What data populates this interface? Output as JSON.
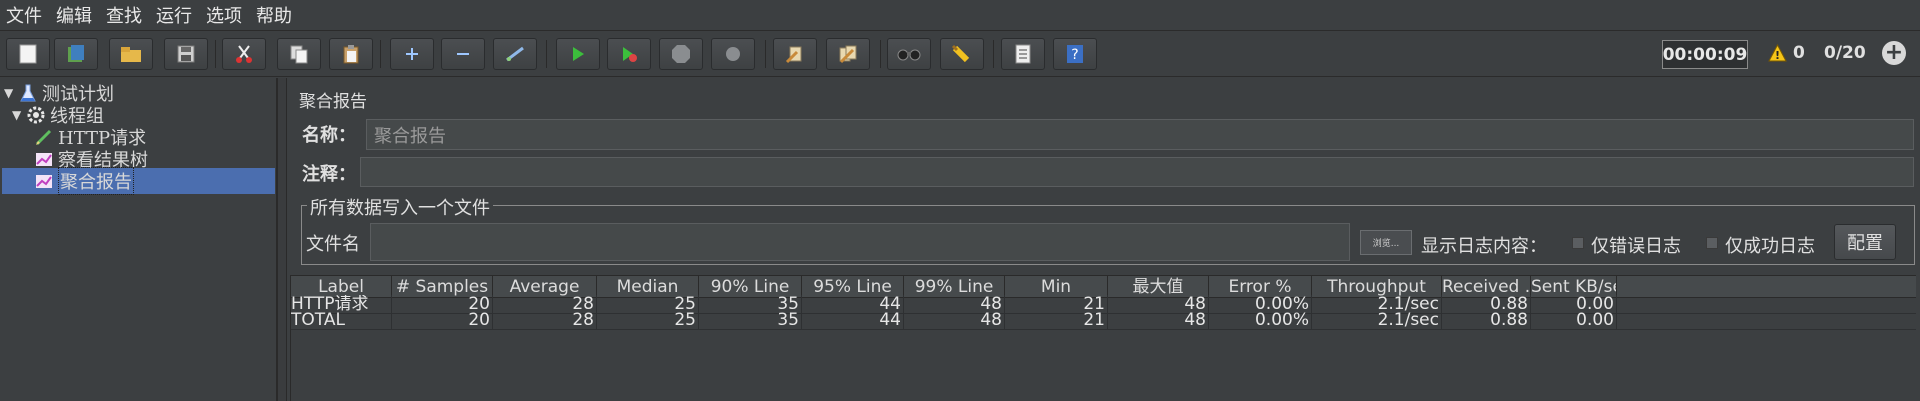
{
  "menu": [
    "文件",
    "编辑",
    "查找",
    "运行",
    "选项",
    "帮助"
  ],
  "toolbar": {
    "buttons": [
      "new-icon",
      "templates-icon",
      "open-icon",
      "save-icon",
      "cut-icon",
      "copy-icon",
      "paste-icon",
      "expand-icon",
      "collapse-icon",
      "toggle-icon",
      "start-icon",
      "start-no-pause-icon",
      "stop-icon",
      "shutdown-icon",
      "clear-icon",
      "clear-all-icon",
      "search-icon",
      "reset-search-icon",
      "function-helper-icon",
      "help-icon"
    ],
    "timer": "00:00:09",
    "warning_count": "0",
    "threads": "0/20"
  },
  "tree": {
    "items": [
      {
        "label": "测试计划",
        "icon": "flask-icon"
      },
      {
        "label": "线程组",
        "icon": "gear-icon"
      },
      {
        "label": "HTTP请求",
        "icon": "pencil-icon"
      },
      {
        "label": "察看结果树",
        "icon": "chart-icon"
      },
      {
        "label": "聚合报告",
        "icon": "chart-icon"
      }
    ]
  },
  "panel": {
    "title": "聚合报告",
    "name_label": "名称：",
    "name_value": "聚合报告",
    "comment_label": "注释：",
    "comment_value": "",
    "group_title": "所有数据写入一个文件",
    "filename_label": "文件名",
    "filename_value": "",
    "browse_label": "浏览...",
    "log_label": "显示日志内容：",
    "errors_only": "仅错误日志",
    "success_only": "仅成功日志",
    "config_button": "配置"
  },
  "table": {
    "headers": [
      "Label",
      "# Samples",
      "Average",
      "Median",
      "90% Line",
      "95% Line",
      "99% Line",
      "Min",
      "最大值",
      "Error %",
      "Throughput",
      "Received ...",
      "Sent KB/sec"
    ],
    "rows": [
      [
        "HTTP请求",
        "20",
        "28",
        "25",
        "35",
        "44",
        "48",
        "21",
        "48",
        "0.00%",
        "2.1/sec",
        "0.88",
        "0.00"
      ],
      [
        "TOTAL",
        "20",
        "28",
        "25",
        "35",
        "44",
        "48",
        "21",
        "48",
        "0.00%",
        "2.1/sec",
        "0.88",
        "0.00"
      ]
    ]
  },
  "colors": {
    "background": "#3c3f41",
    "selection": "#4b6eaf",
    "warning": "#f5c518"
  }
}
